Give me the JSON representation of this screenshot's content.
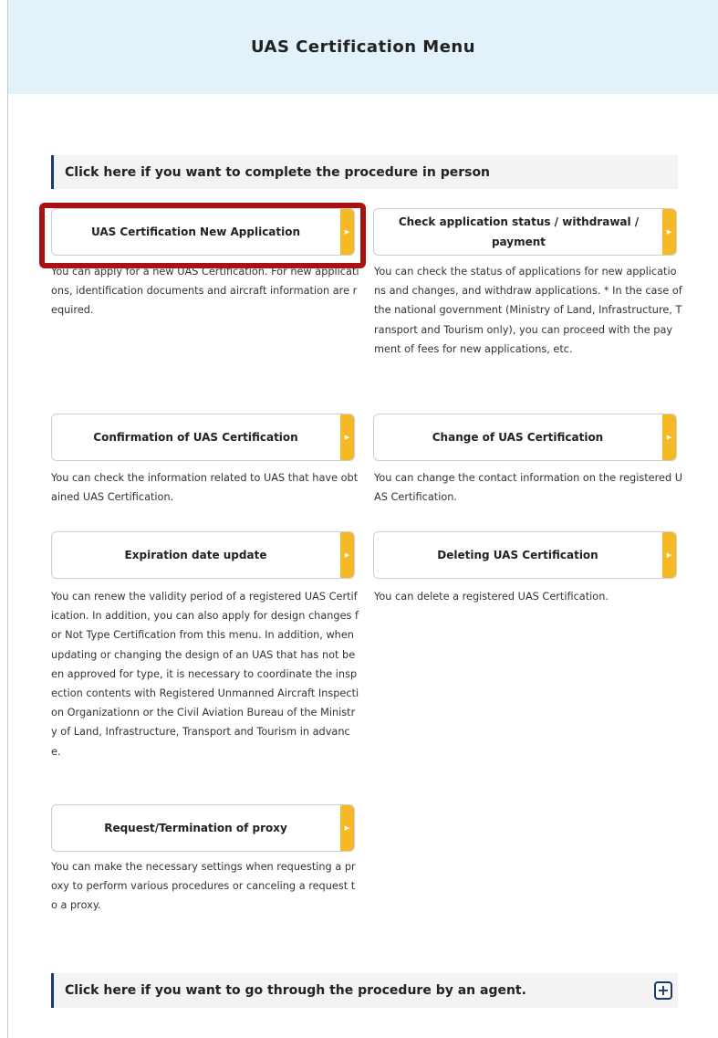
{
  "header": {
    "title": "UAS Certification Menu"
  },
  "sections": {
    "in_person": "Click here if you want to complete the procedure in person",
    "agent": "Click here if you want to go through the procedure by an agent."
  },
  "cards": {
    "new_application": {
      "label": "UAS Certification New Application",
      "desc": "You can apply for a new UAS Certification. For new applications, identification documents and aircraft information are required."
    },
    "check_status": {
      "label": "Check application status / withdrawal / payment",
      "desc": "You can check the status of applications for new applications and changes, and withdraw applications. * In the case of the national government (Ministry of Land, Infrastructure, Transport and Tourism only), you can proceed with the payment of fees for new applications, etc."
    },
    "confirmation": {
      "label": "Confirmation of UAS Certification",
      "desc": "You can check the information related to UAS that have obtained UAS Certification."
    },
    "change": {
      "label": "Change of UAS Certification",
      "desc": "You can change the contact information on the registered UAS Certification."
    },
    "expiration": {
      "label": "Expiration date update",
      "desc": "You can renew the validity period of a registered UAS Certification. In addition, you can also apply for design changes for Not Type Certification from this menu. In addition, when updating or changing the design of an UAS that has not been approved for type, it is necessary to coordinate the inspection contents with Registered Unmanned Aircraft Inspection Organizationn or the Civil Aviation Bureau of the Ministry of Land, Infrastructure, Transport and Tourism in advance."
    },
    "deleting": {
      "label": "Deleting UAS Certification",
      "desc": "You can delete a registered UAS Certification."
    },
    "proxy": {
      "label": "Request/Termination of proxy",
      "desc": "You can make the necessary settings when requesting a proxy to perform various procedures or canceling a request to a proxy."
    }
  },
  "icons": {
    "arrow": "chevron-right-icon",
    "expand": "plus-icon"
  },
  "colors": {
    "header_bg": "#e3f1fb",
    "accent_tab": "#f6b926",
    "highlight": "#a81212",
    "section_bar": "#1a3a6b"
  }
}
